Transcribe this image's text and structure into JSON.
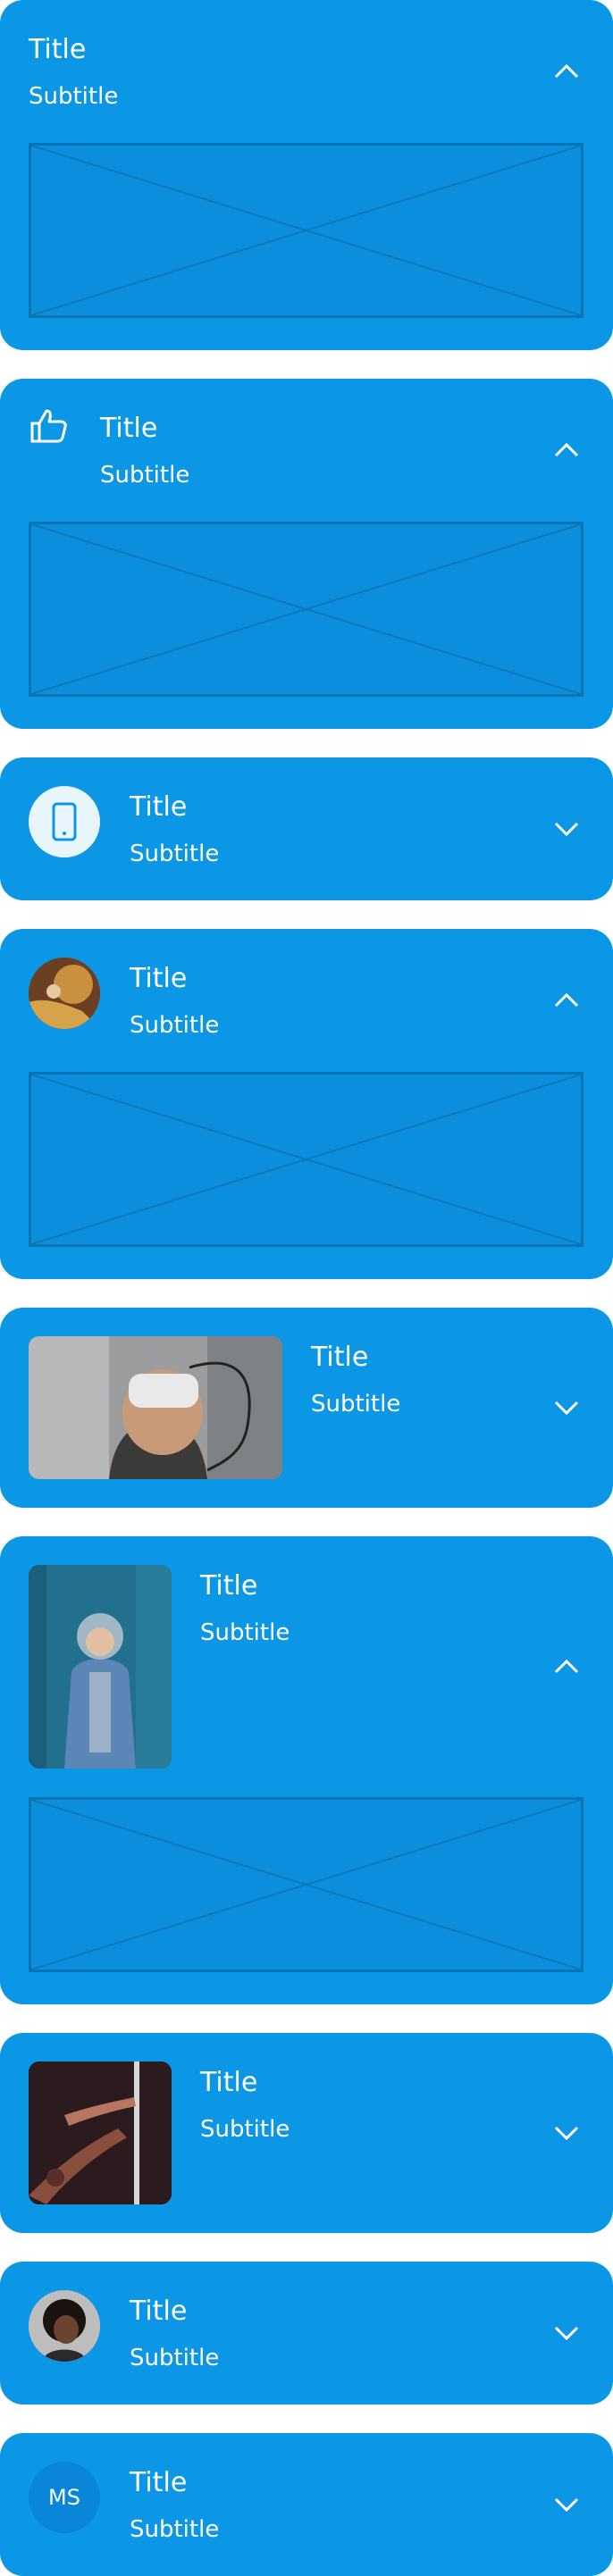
{
  "cards": [
    {
      "title": "Title",
      "subtitle": "Subtitle",
      "state": "expanded",
      "leading": "none",
      "content": "image-placeholder"
    },
    {
      "title": "Title",
      "subtitle": "Subtitle",
      "state": "expanded",
      "leading": "thumbs-up-icon",
      "content": "image-placeholder"
    },
    {
      "title": "Title",
      "subtitle": "Subtitle",
      "state": "collapsed",
      "leading": "phone-icon"
    },
    {
      "title": "Title",
      "subtitle": "Subtitle",
      "state": "expanded",
      "leading": "avatar-photo",
      "content": "image-placeholder"
    },
    {
      "title": "Title",
      "subtitle": "Subtitle",
      "state": "collapsed",
      "leading": "vr-headset-photo"
    },
    {
      "title": "Title",
      "subtitle": "Subtitle",
      "state": "expanded",
      "leading": "person-hoodie-photo",
      "content": "image-placeholder"
    },
    {
      "title": "Title",
      "subtitle": "Subtitle",
      "state": "collapsed",
      "leading": "hands-photo"
    },
    {
      "title": "Title",
      "subtitle": "Subtitle",
      "state": "collapsed",
      "leading": "avatar-photo"
    },
    {
      "title": "Title",
      "subtitle": "Subtitle",
      "state": "collapsed",
      "leading": "initials-avatar",
      "initials": "MS"
    }
  ],
  "colors": {
    "card": "#0c97e6",
    "placeholder_border": "#0a73b3",
    "avatar_light": "#e8f5fd",
    "initials_bg": "#0a86d8"
  },
  "icons": {
    "expanded": "chevron-up-icon",
    "collapsed": "chevron-down-icon"
  }
}
